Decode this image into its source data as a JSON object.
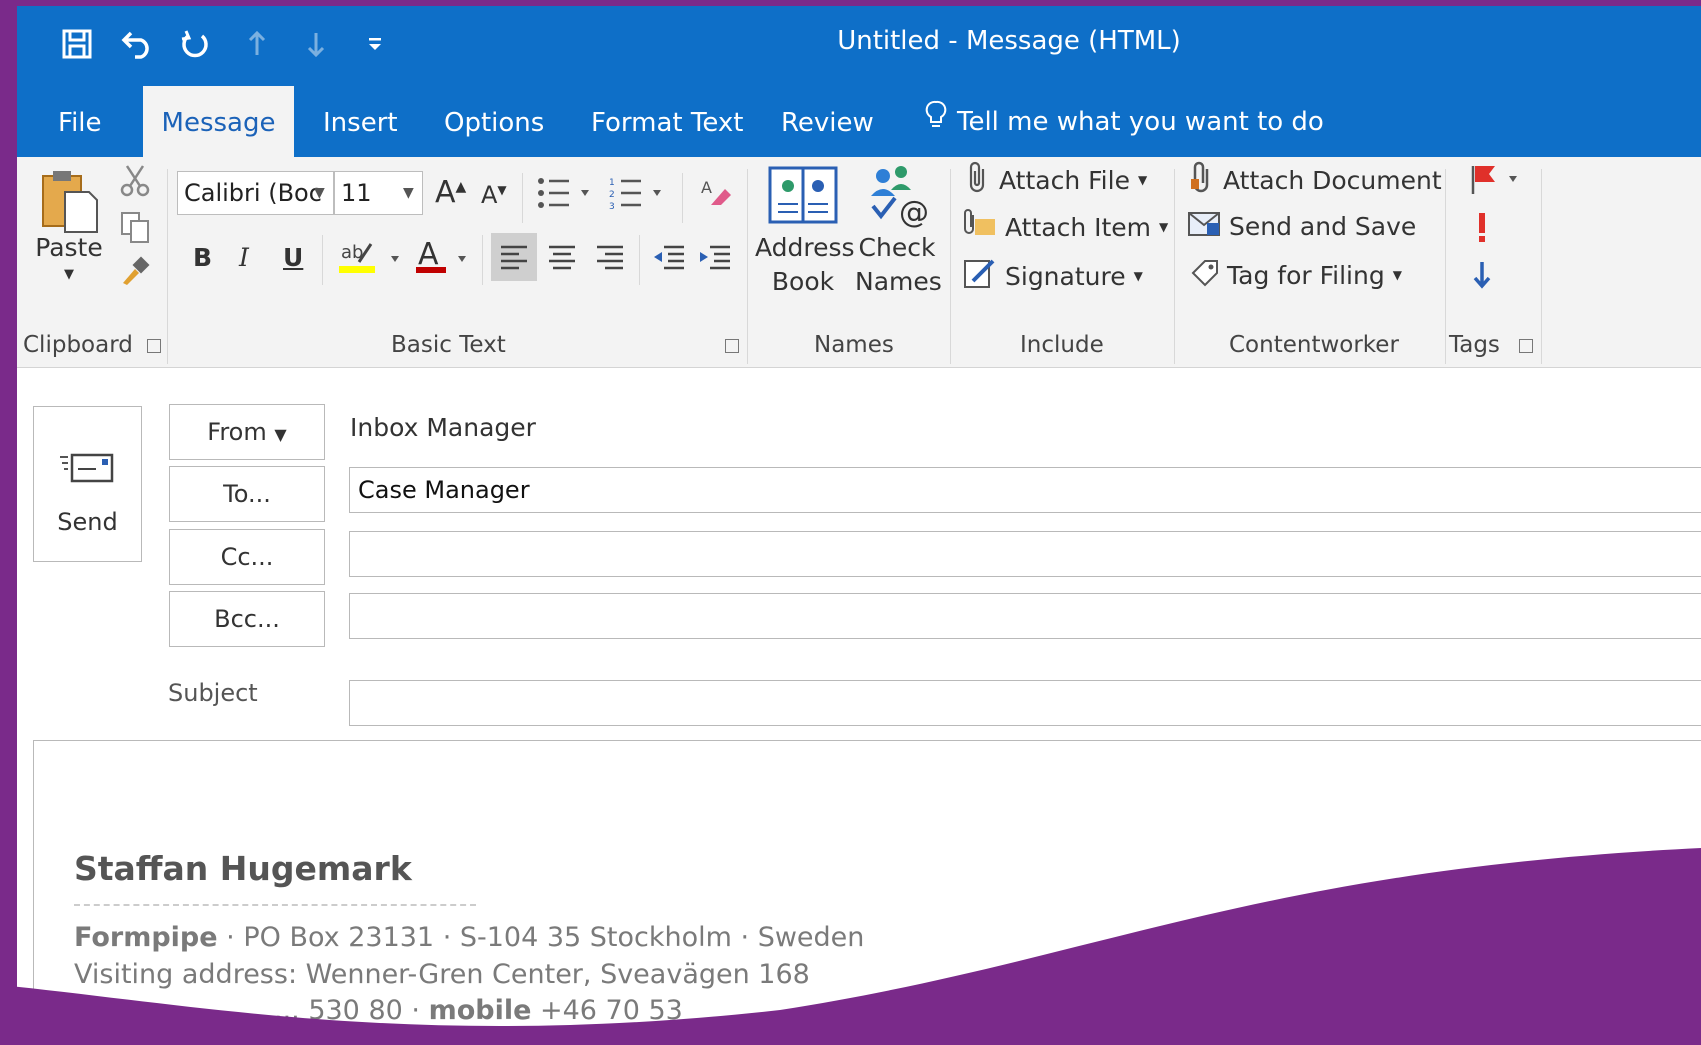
{
  "window": {
    "title": "Untitled  -  Message (HTML)"
  },
  "quick_access": {
    "icons": [
      "save-icon",
      "undo-icon",
      "redo-icon",
      "up-arrow-icon",
      "down-arrow-icon",
      "customize-qat-icon"
    ]
  },
  "tabs": [
    {
      "label": "File"
    },
    {
      "label": "Message"
    },
    {
      "label": "Insert"
    },
    {
      "label": "Options"
    },
    {
      "label": "Format Text"
    },
    {
      "label": "Review"
    }
  ],
  "tell_me": "Tell me what you want to do",
  "ribbon": {
    "clipboard": {
      "group_label": "Clipboard",
      "paste_label": "Paste"
    },
    "basic_text": {
      "group_label": "Basic Text",
      "font_name": "Calibri (Boc",
      "font_size": "11",
      "bold": "B",
      "italic": "I",
      "underline": "U"
    },
    "names": {
      "group_label": "Names",
      "address_book_line1": "Address",
      "address_book_line2": "Book",
      "check_names_line1": "Check",
      "check_names_line2": "Names"
    },
    "include": {
      "group_label": "Include",
      "attach_file": "Attach File",
      "attach_item": "Attach Item",
      "signature": "Signature"
    },
    "contentworker": {
      "group_label": "Contentworker",
      "attach_document": "Attach Document",
      "send_and_save": "Send and Save",
      "tag_for_filing": "Tag for Filing"
    },
    "tags": {
      "group_label": "Tags"
    }
  },
  "compose": {
    "send_label": "Send",
    "from_label": "From",
    "from_value": "Inbox Manager",
    "to_label": "To...",
    "to_value": "Case Manager",
    "cc_label": "Cc...",
    "cc_value": "",
    "bcc_label": "Bcc...",
    "bcc_value": "",
    "subject_label": "Subject",
    "subject_value": ""
  },
  "signature": {
    "name": "Staffan Hugemark",
    "company": "Formpipe",
    "postal": " · PO Box 23131 · S-104 35 Stockholm · Sweden",
    "visiting": "Visiting address: Wenner-Gren Center, Sveavägen 168",
    "phone_fragment": "... 530 80 · ",
    "mobile_label": "mobile",
    "mobile_fragment": " +46 70 53"
  },
  "colors": {
    "accent": "#0e6fc8",
    "frame": "#7a2a8a"
  }
}
